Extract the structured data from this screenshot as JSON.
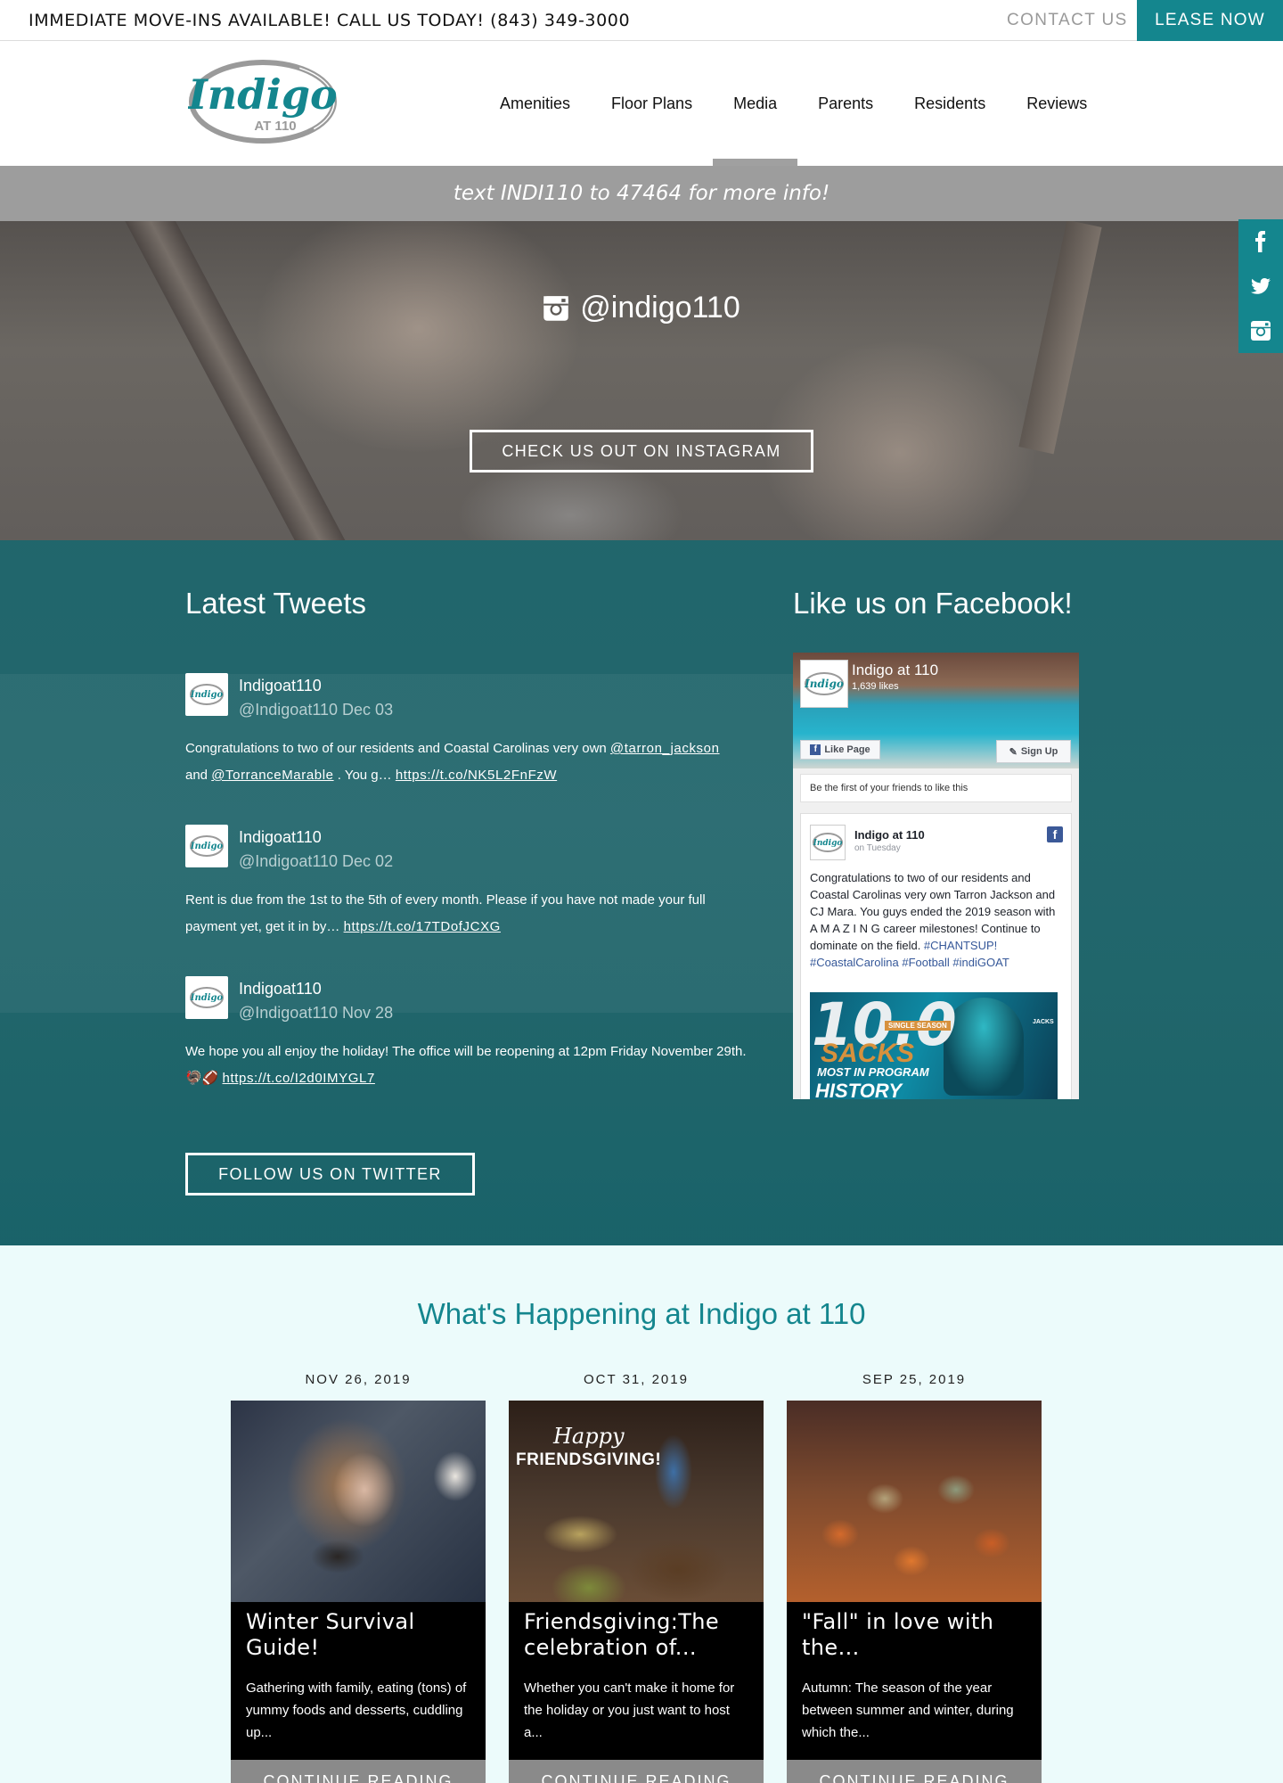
{
  "topbar": {
    "promo": "IMMEDIATE MOVE-INS AVAILABLE! CALL US TODAY! (843) 349-3000",
    "contact": "CONTACT US",
    "lease": "LEASE NOW"
  },
  "brand": {
    "logo_main": "Indigo",
    "logo_sub": "AT 110",
    "accent": "#14868e"
  },
  "nav": [
    {
      "label": "Amenities"
    },
    {
      "label": "Floor Plans"
    },
    {
      "label": "Media",
      "active": true
    },
    {
      "label": "Parents"
    },
    {
      "label": "Residents"
    },
    {
      "label": "Reviews"
    }
  ],
  "banner": {
    "text": "text INDI110 to 47464 for more info!"
  },
  "instagram": {
    "handle": "@indigo110",
    "button": "CHECK US OUT ON INSTAGRAM"
  },
  "social": [
    "facebook-icon",
    "twitter-icon",
    "instagram-icon"
  ],
  "tweets_section": {
    "title": "Latest Tweets",
    "follow": "FOLLOW US ON TWITTER",
    "tweets": [
      {
        "name": "Indigoat110",
        "handle": "@Indigoat110",
        "date": "Dec 03",
        "text1": "Congratulations to two of our residents and Coastal Carolinas very own ",
        "mention1": "@tarron_jackson",
        "text2": "and ",
        "mention2": "@TorranceMarable",
        "text3": " . You g… ",
        "link": "https://t.co/NK5L2FnFzW"
      },
      {
        "name": "Indigoat110",
        "handle": "@Indigoat110",
        "date": "Dec 02",
        "text1": "Rent is due from the 1st to the 5th of every month. Please if you have not made your full payment yet, get it in by… ",
        "link": "https://t.co/17TDofJCXG"
      },
      {
        "name": "Indigoat110",
        "handle": "@Indigoat110",
        "date": "Nov 28",
        "text1": "We hope you all enjoy the holiday! The office will be reopening at 12pm Friday November 29th. 🦃🏈 ",
        "link": "https://t.co/I2d0IMYGL7"
      }
    ]
  },
  "facebook_section": {
    "title": "Like us on Facebook!",
    "page_name": "Indigo at 110",
    "likes": "1,639 likes",
    "like_button": "Like Page",
    "signup_button": "Sign Up",
    "friends_text": "Be the first of your friends to like this",
    "post_name": "Indigo at 110",
    "post_time": "on Tuesday",
    "post_text": "Congratulations to two of our residents and Coastal Carolinas very own Tarron Jackson and CJ Mara. You guys ended the 2019 season with A M A Z I N G career milestones! Continue to dominate on the field. ",
    "post_tags": "#CHANTSUP! #CoastalCarolina #Football #indiGOAT",
    "img_big": "10.0",
    "img_sacks": "SACKS",
    "img_single": "SINGLE SEASON",
    "img_mip": "MOST IN PROGRAM",
    "img_hist": "HISTORY",
    "img_jack": "JACKS"
  },
  "happening": {
    "title": "What's Happening at Indigo at 110",
    "more": "CONTINUE READING",
    "posts": [
      {
        "date": "NOV 26, 2019",
        "title": "Winter Survival Guide!",
        "excerpt": "Gathering with family, eating (tons) of yummy foods and desserts, cuddling up..."
      },
      {
        "date": "OCT 31, 2019",
        "title": "Friendsgiving:The celebration of...",
        "excerpt": "Whether you can't make it home for the holiday or you just want to host a...",
        "img_happy": "Happy",
        "img_fg": "FRIENDSGIVING!"
      },
      {
        "date": "SEP 25, 2019",
        "title": "\"Fall\" in love with the...",
        "excerpt": "Autumn: The season of the year between summer and winter, during which the..."
      }
    ]
  }
}
